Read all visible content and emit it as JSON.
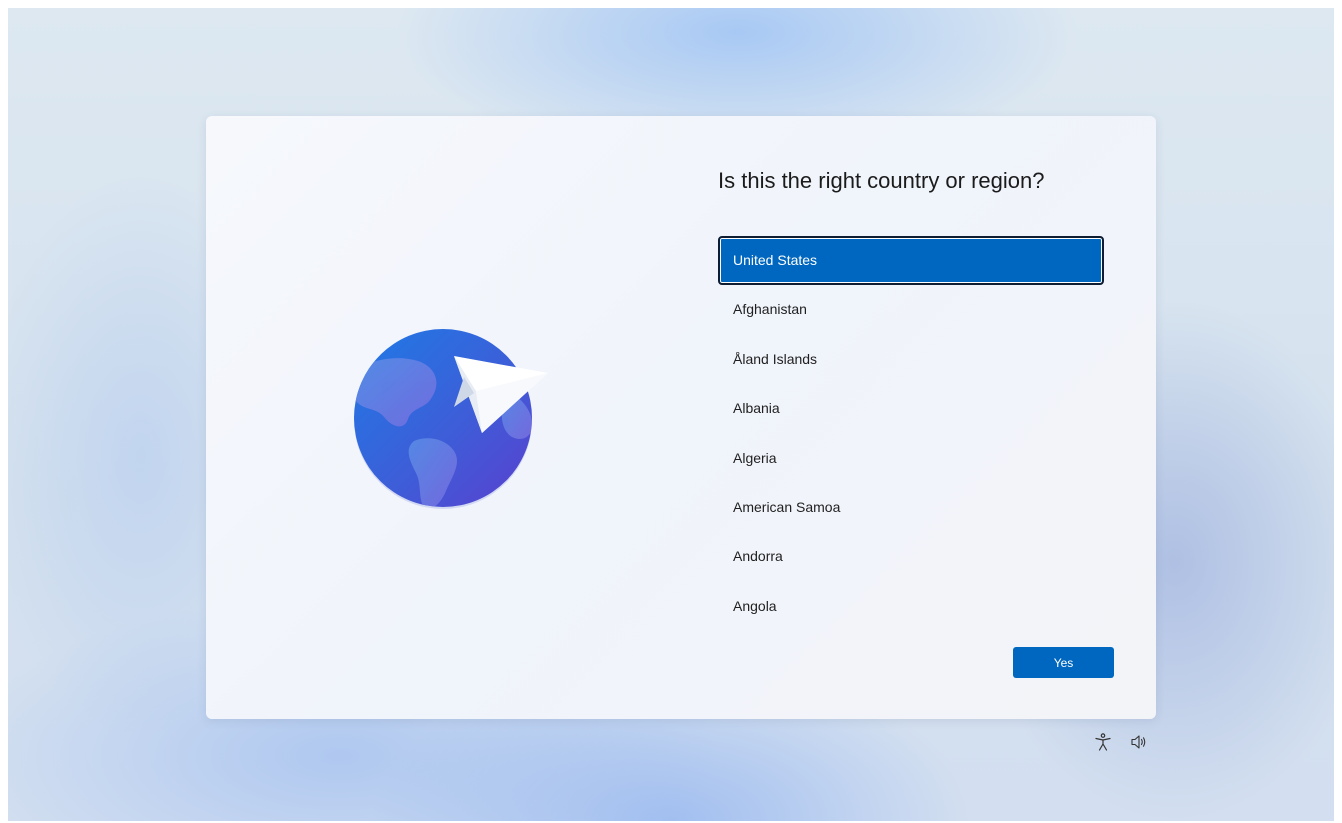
{
  "setup": {
    "title": "Is this the right country or region?",
    "countries": [
      "United States",
      "Afghanistan",
      "Åland Islands",
      "Albania",
      "Algeria",
      "American Samoa",
      "Andorra",
      "Angola"
    ],
    "selected_country": "United States",
    "yes_label": "Yes"
  },
  "icons": {
    "illustration": "globe-paper-plane-icon",
    "accessibility": "accessibility-icon",
    "volume": "volume-icon"
  },
  "colors": {
    "accent": "#0067c0",
    "selected_border": "#0f1d33",
    "title_text": "#1b1b1b",
    "globe_blue": "#2f6fdc",
    "globe_purple": "#5b43cf"
  }
}
